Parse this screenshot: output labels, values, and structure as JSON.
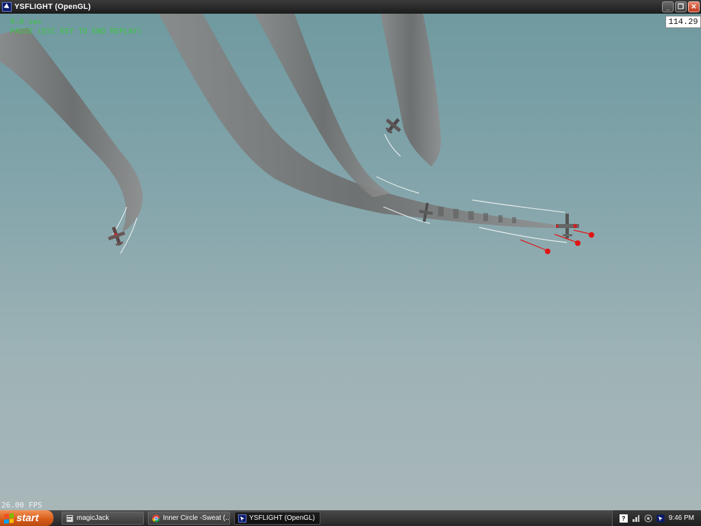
{
  "window": {
    "title": "YSFLIGHT (OpenGL)",
    "controls": {
      "minimize": "_",
      "restore": "❐",
      "close": "✕"
    }
  },
  "hud": {
    "line1": "0.0 sec",
    "line2": "PAUSE (ESC KEY TO END REPLAY)",
    "timer": "114.29",
    "fps": "26.00 FPS"
  },
  "taskbar": {
    "start_label": "start",
    "tasks": [
      {
        "label": "magicJack",
        "icon": "calculator-icon"
      },
      {
        "label": "Inner Circle -Sweat (...",
        "icon": "chrome-icon"
      },
      {
        "label": "YSFLIGHT (OpenGL)",
        "icon": "ysflight-icon",
        "active": true
      }
    ],
    "tray": {
      "help": "?",
      "clock": "9:46 PM"
    }
  },
  "colors": {
    "sky_top": "#6f9aa0",
    "sky_bottom": "#a8b6b8",
    "smoke": "#7a7a7a",
    "hud_text": "#3ac73a",
    "tracer": "#e01515"
  }
}
